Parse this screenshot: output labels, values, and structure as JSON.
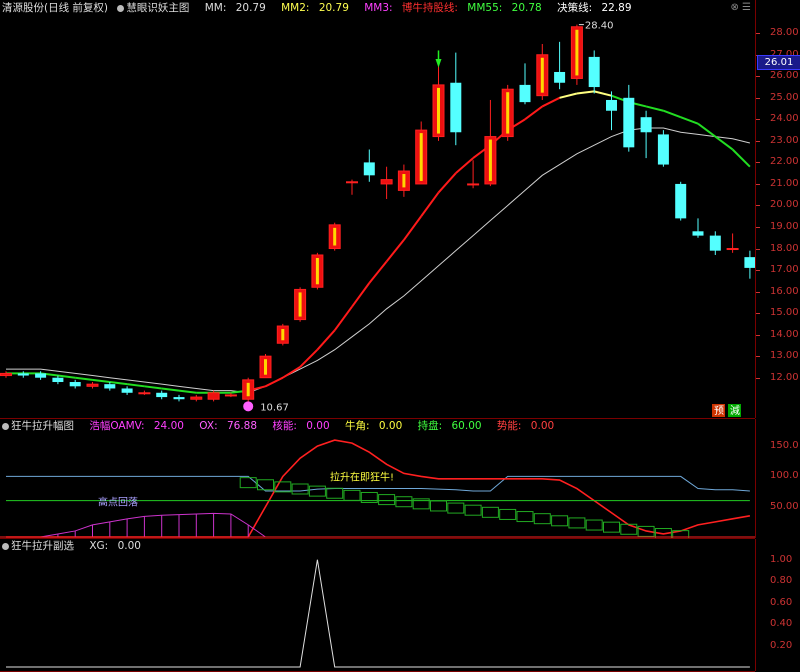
{
  "panel1": {
    "stock": "清源股份",
    "period": "(日线 前复权)",
    "indicator": "慧眼识妖主图",
    "mm_label": "MM:",
    "mm_value": "20.79",
    "mm2_label": "MM2:",
    "mm2_value": "20.79",
    "mm3_label": "MM3:",
    "hold_label": "博牛持股线:",
    "mm55_label": "MM55:",
    "mm55_value": "20.78",
    "jc_label": "决策线:",
    "jc_value": "22.89",
    "high_label": "28.40",
    "low_label": "10.67",
    "current_price": "26.01",
    "yu_badge": "预",
    "jian_badge": "減",
    "colors": {
      "up": "#ff2020",
      "down": "#54ffff",
      "hold": "#ff0000",
      "mm55": "#ffffff",
      "jc": "#22dd22"
    }
  },
  "panel2": {
    "title": "狂牛拉升幅图",
    "zm_label": "浩幅OAMV:",
    "zm_value": "24.00",
    "ox_label": "OX:",
    "ox_value": "76.88",
    "hn_label": "核能:",
    "hn_value": "0.00",
    "nj_label": "牛角:",
    "nj_value": "0.00",
    "cp_label": "持盘:",
    "cp_value": "60.00",
    "sn_label": "势能:",
    "sn_value": "0.00",
    "annot_pull": "拉升在即狂牛!",
    "annot_high": "高点回落"
  },
  "panel3": {
    "title": "狂牛拉升副选",
    "xg_label": "XG:",
    "xg_value": "0.00"
  },
  "axis1_ticks": [
    "28.00",
    "27.00",
    "26.00",
    "25.00",
    "24.00",
    "23.00",
    "22.00",
    "21.00",
    "20.00",
    "19.00",
    "18.00",
    "17.00",
    "16.00",
    "15.00",
    "14.00",
    "13.00",
    "12.00"
  ],
  "axis2_ticks": [
    "150.0",
    "100.0",
    "50.00"
  ],
  "axis3_ticks": [
    "1.00",
    "0.80",
    "0.60",
    "0.40",
    "0.20"
  ],
  "chart_data": [
    {
      "type": "candlestick",
      "y_range": [
        10.5,
        28.8
      ],
      "candles": [
        {
          "o": 12.1,
          "c": 12.2,
          "h": 12.3,
          "l": 12.0
        },
        {
          "o": 12.2,
          "c": 12.1,
          "h": 12.3,
          "l": 12.0
        },
        {
          "o": 12.2,
          "c": 12.0,
          "h": 12.3,
          "l": 11.9
        },
        {
          "o": 12.0,
          "c": 11.8,
          "h": 12.1,
          "l": 11.7
        },
        {
          "o": 11.8,
          "c": 11.6,
          "h": 11.9,
          "l": 11.5
        },
        {
          "o": 11.6,
          "c": 11.7,
          "h": 11.8,
          "l": 11.5
        },
        {
          "o": 11.7,
          "c": 11.5,
          "h": 11.8,
          "l": 11.4
        },
        {
          "o": 11.5,
          "c": 11.3,
          "h": 11.6,
          "l": 11.2
        },
        {
          "o": 11.3,
          "c": 11.3,
          "h": 11.4,
          "l": 11.2
        },
        {
          "o": 11.3,
          "c": 11.1,
          "h": 11.4,
          "l": 11.0
        },
        {
          "o": 11.1,
          "c": 11.0,
          "h": 11.2,
          "l": 10.9
        },
        {
          "o": 11.0,
          "c": 11.1,
          "h": 11.2,
          "l": 10.9
        },
        {
          "o": 11.0,
          "c": 11.3,
          "h": 11.4,
          "l": 10.9
        },
        {
          "o": 11.2,
          "c": 11.2,
          "h": 11.3,
          "l": 11.1
        },
        {
          "o": 11.0,
          "c": 11.9,
          "h": 12.0,
          "l": 10.7
        },
        {
          "o": 12.0,
          "c": 13.0,
          "h": 13.1,
          "l": 12.0
        },
        {
          "o": 13.6,
          "c": 14.4,
          "h": 14.5,
          "l": 13.5
        },
        {
          "o": 14.7,
          "c": 16.1,
          "h": 16.2,
          "l": 14.6
        },
        {
          "o": 16.2,
          "c": 17.7,
          "h": 17.8,
          "l": 16.1
        },
        {
          "o": 18.0,
          "c": 19.1,
          "h": 19.2,
          "l": 17.9
        },
        {
          "o": 21.1,
          "c": 21.1,
          "h": 21.2,
          "l": 20.5
        },
        {
          "o": 22.0,
          "c": 21.4,
          "h": 22.6,
          "l": 21.1
        },
        {
          "o": 21.0,
          "c": 21.2,
          "h": 21.8,
          "l": 20.3
        },
        {
          "o": 20.7,
          "c": 21.6,
          "h": 21.9,
          "l": 20.4
        },
        {
          "o": 21.0,
          "c": 23.5,
          "h": 23.9,
          "l": 21.0
        },
        {
          "o": 23.2,
          "c": 25.6,
          "h": 26.5,
          "l": 23.0
        },
        {
          "o": 25.7,
          "c": 23.4,
          "h": 27.1,
          "l": 22.8
        },
        {
          "o": 21.0,
          "c": 21.0,
          "h": 22.1,
          "l": 20.8
        },
        {
          "o": 21.0,
          "c": 23.2,
          "h": 24.9,
          "l": 20.9
        },
        {
          "o": 23.2,
          "c": 25.4,
          "h": 25.6,
          "l": 23.0
        },
        {
          "o": 25.6,
          "c": 24.8,
          "h": 26.6,
          "l": 24.7
        },
        {
          "o": 25.1,
          "c": 27.0,
          "h": 27.5,
          "l": 24.9
        },
        {
          "o": 26.2,
          "c": 25.7,
          "h": 27.6,
          "l": 25.4
        },
        {
          "o": 25.9,
          "c": 28.3,
          "h": 28.4,
          "l": 25.6
        },
        {
          "o": 26.9,
          "c": 25.5,
          "h": 27.2,
          "l": 25.2
        },
        {
          "o": 24.9,
          "c": 24.4,
          "h": 25.3,
          "l": 23.5
        },
        {
          "o": 25.0,
          "c": 22.7,
          "h": 25.6,
          "l": 22.5
        },
        {
          "o": 24.1,
          "c": 23.4,
          "h": 24.4,
          "l": 22.2
        },
        {
          "o": 23.3,
          "c": 21.9,
          "h": 23.5,
          "l": 21.8
        },
        {
          "o": 21.0,
          "c": 19.4,
          "h": 21.1,
          "l": 19.3
        },
        {
          "o": 18.8,
          "c": 18.6,
          "h": 19.4,
          "l": 18.5
        },
        {
          "o": 18.6,
          "c": 17.9,
          "h": 18.8,
          "l": 17.7
        },
        {
          "o": 18.0,
          "c": 18.0,
          "h": 18.7,
          "l": 17.8
        },
        {
          "o": 17.6,
          "c": 17.1,
          "h": 17.9,
          "l": 16.6
        }
      ],
      "hold_line": [
        12.2,
        12.2,
        12.2,
        12.1,
        12.0,
        11.9,
        11.8,
        11.7,
        11.6,
        11.5,
        11.4,
        11.3,
        11.3,
        11.3,
        11.4,
        11.6,
        12.0,
        12.5,
        13.3,
        14.2,
        15.3,
        16.4,
        17.4,
        18.4,
        19.5,
        20.6,
        21.5,
        22.2,
        22.8,
        23.5,
        24.0,
        24.6,
        25.0,
        25.2,
        25.3,
        25.1,
        24.8,
        24.6,
        24.4,
        24.1,
        23.8,
        23.2,
        22.6,
        21.8
      ],
      "mm55": [
        12.4,
        12.4,
        12.4,
        12.3,
        12.2,
        12.1,
        12.0,
        11.9,
        11.8,
        11.7,
        11.6,
        11.5,
        11.4,
        11.4,
        11.3,
        11.6,
        12.0,
        12.4,
        12.8,
        13.3,
        13.9,
        14.5,
        15.2,
        15.8,
        16.5,
        17.2,
        17.9,
        18.6,
        19.3,
        20.0,
        20.7,
        21.4,
        21.9,
        22.4,
        22.8,
        23.2,
        23.5,
        23.6,
        23.6,
        23.4,
        23.3,
        23.2,
        23.1,
        22.9
      ]
    },
    {
      "type": "line",
      "y_range": [
        0,
        175
      ],
      "series": [
        {
          "name": "浩幅OAMV",
          "values": [
            100,
            100,
            100,
            100,
            100,
            100,
            100,
            100,
            100,
            100,
            100,
            100,
            100,
            100,
            100,
            76,
            76,
            76,
            79,
            80,
            80,
            80,
            80,
            80,
            80,
            79,
            78,
            76,
            76,
            100,
            100,
            100,
            100,
            100,
            100,
            100,
            100,
            100,
            100,
            100,
            80,
            78,
            78,
            76
          ]
        },
        {
          "name": "OX",
          "values": [
            0,
            0,
            0,
            0,
            0,
            0,
            0,
            0,
            0,
            0,
            0,
            0,
            0,
            0,
            0,
            50,
            100,
            130,
            150,
            160,
            155,
            140,
            120,
            105,
            100,
            96,
            96,
            96,
            96,
            96,
            96,
            96,
            94,
            80,
            60,
            40,
            20,
            10,
            5,
            10,
            20,
            25,
            30,
            35
          ]
        },
        {
          "name": "持盘",
          "values": [
            60,
            60,
            60,
            60,
            60,
            60,
            60,
            60,
            60,
            60,
            60,
            60,
            60,
            60,
            60,
            60,
            60,
            60,
            60,
            60,
            60,
            60,
            60,
            60,
            60,
            60,
            60,
            60,
            60,
            60,
            60,
            60,
            60,
            60,
            60,
            60,
            60,
            60,
            60,
            60,
            60,
            60,
            60,
            60
          ]
        },
        {
          "name": "高点回落",
          "values": [
            0,
            0,
            0,
            5,
            10,
            20,
            25,
            30,
            34,
            36,
            37,
            38,
            39,
            38,
            20,
            0,
            0,
            0,
            0,
            0,
            0,
            0,
            0,
            0,
            0,
            0,
            0,
            0,
            0,
            0,
            0,
            0,
            0,
            0,
            0,
            0,
            0,
            0,
            0,
            0,
            0,
            0,
            0,
            0
          ]
        }
      ]
    },
    {
      "type": "line",
      "y_range": [
        0,
        1.1
      ],
      "series": [
        {
          "name": "XG",
          "values": [
            0,
            0,
            0,
            0,
            0,
            0,
            0,
            0,
            0,
            0,
            0,
            0,
            0,
            0,
            0,
            0,
            0,
            0,
            1,
            0,
            0,
            0,
            0,
            0,
            0,
            0,
            0,
            0,
            0,
            0,
            0,
            0,
            0,
            0,
            0,
            0,
            0,
            0,
            0,
            0,
            0,
            0,
            0,
            0
          ]
        }
      ]
    }
  ]
}
